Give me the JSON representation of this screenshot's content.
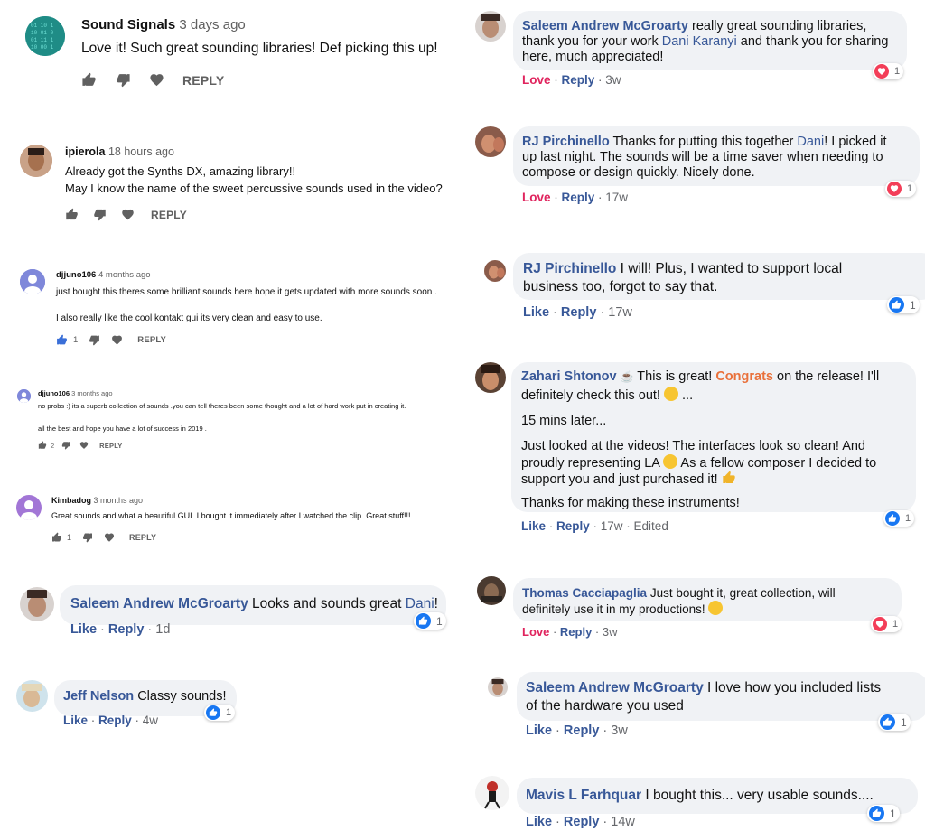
{
  "yt": [
    {
      "author": "Sound Signals",
      "time": "3 days ago",
      "lines": [
        "Love it! Such great sounding libraries! Def picking this up!"
      ],
      "likes": "",
      "reply": "REPLY"
    },
    {
      "author": "ipierola",
      "time": "18 hours ago",
      "lines": [
        "Already got the Synths DX, amazing library!!",
        "May I know the name of the sweet percussive sounds used in the video?"
      ],
      "likes": "",
      "reply": "REPLY"
    },
    {
      "author": "djjuno106",
      "time": "4 months ago",
      "lines": [
        "just bought this theres some brilliant sounds here hope it gets updated with more sounds soon .",
        "I also really like the cool kontakt gui its very clean and easy to use."
      ],
      "likes": "1",
      "reply": "REPLY"
    },
    {
      "author": "djjuno106",
      "time": "3 months ago",
      "lines": [
        "no probs :) its a superb collection of sounds .you can tell theres been some thought and a lot of hard work put in creating it.",
        "all the best and hope you have a lot of success in 2019 ."
      ],
      "likes": "2",
      "reply": "REPLY"
    },
    {
      "author": "Kimbadog",
      "time": "3 months ago",
      "lines": [
        "Great sounds and what a beautiful GUI. I bought it immediately after I watched the clip. Great stuff!!!"
      ],
      "likes": "1",
      "reply": "REPLY"
    }
  ],
  "fb": {
    "c1": {
      "name": "Saleem Andrew McGroarty",
      "t1": " really great sounding libraries,",
      "t2": "thank you for your work ",
      "mention": "Dani Karanyi",
      "t2b": " and thank you for sharing",
      "t3": "here, much appreciated!",
      "action": "Love",
      "reply": "Reply",
      "time": "3w",
      "count": "1"
    },
    "c2": {
      "name": "RJ Pirchinello",
      "t1": " Thanks for putting this together ",
      "mention": "Dani",
      "t1b": "! I picked it",
      "t2": "up last night. The sounds will be a time saver when needing to",
      "t3": "compose or design quickly. Nicely done.",
      "action": "Love",
      "reply": "Reply",
      "time": "17w",
      "count": "1"
    },
    "c3": {
      "name": "RJ Pirchinello",
      "t1": " I will! Plus, I wanted to support local",
      "t2": "business too, forgot to say that.",
      "action": "Like",
      "reply": "Reply",
      "time": "17w",
      "count": "1"
    },
    "c4": {
      "name": "Zahari Shtonov",
      "t1": " This is great! ",
      "congrats": "Congrats",
      "t1b": " on the release! I'll",
      "t2": "definitely check this out! ",
      "t2b": " ...",
      "p2": "15 mins later...",
      "p3a": "Just looked at the videos! The interfaces look so clean! And",
      "p3b": "proudly representing LA ",
      "p3b2": " As a fellow composer I decided to",
      "p3c": "support you and just purchased it! ",
      "p4": "Thanks for making these instruments!",
      "action": "Like",
      "reply": "Reply",
      "time": "17w",
      "edited": "Edited",
      "count": "1"
    },
    "c5": {
      "name": "Thomas Cacciapaglia",
      "t1": " Just bought it, great collection, will",
      "t2": "definitely use it in my productions! ",
      "action": "Love",
      "reply": "Reply",
      "time": "3w",
      "count": "1"
    },
    "c6": {
      "name": "Saleem Andrew McGroarty",
      "t1": " I love how you included lists",
      "t2": "of the hardware you used",
      "action": "Like",
      "reply": "Reply",
      "time": "3w",
      "count": "1"
    },
    "c7": {
      "name": "Mavis L Farhquar",
      "t1": " I bought this... very usable sounds....",
      "action": "Like",
      "reply": "Reply",
      "time": "14w",
      "count": "1"
    },
    "c8": {
      "name": "Saleem Andrew McGroarty",
      "t1": " Looks and sounds great ",
      "mention": "Dani",
      "t1b": "!",
      "action": "Like",
      "reply": "Reply",
      "time": "1d",
      "count": "1"
    },
    "c9": {
      "name": "Jeff Nelson",
      "t1": " Classy sounds!",
      "action": "Like",
      "reply": "Reply",
      "time": "4w",
      "count": "1"
    },
    "sep": " · "
  },
  "colors": {
    "fb_link": "#385898",
    "love": "#e0245e",
    "bubble": "#f0f2f5",
    "yt_meta": "#606060",
    "congrats": "#e9713b"
  },
  "icons": [
    "thumbs-up-icon",
    "thumbs-down-icon",
    "heart-icon",
    "like-reaction-icon",
    "love-reaction-icon",
    "smiley-emoji-icon",
    "wink-emoji-icon",
    "thumbs-up-emoji-icon",
    "coffee-icon"
  ]
}
